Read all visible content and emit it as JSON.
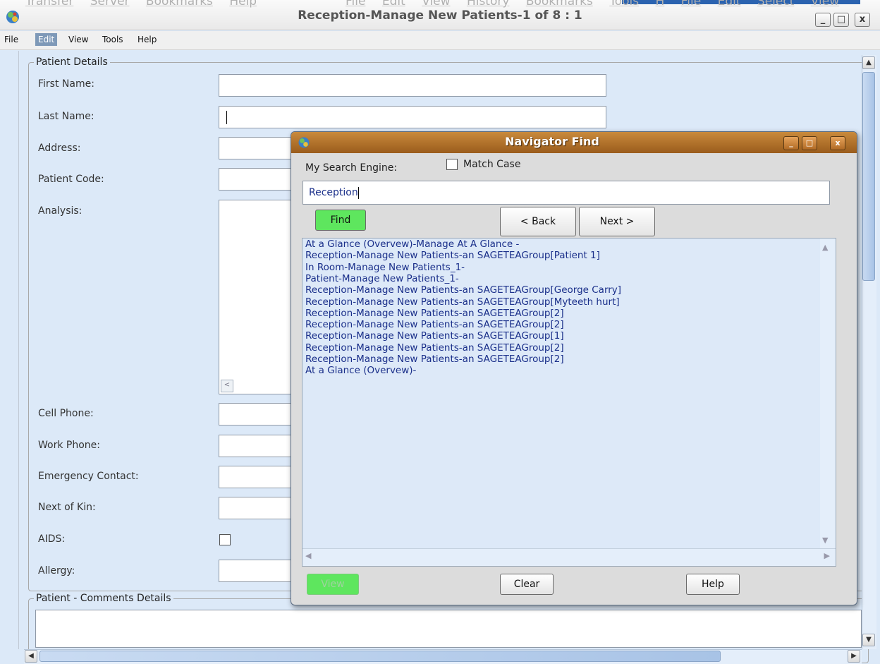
{
  "window": {
    "title": "Reception-Manage New Patients-1 of 8 : 1",
    "ghost_menu_left": [
      "Transfer",
      "Server",
      "Bookmarks",
      "Help"
    ],
    "ghost_menu_right": [
      "File",
      "Edit",
      "View",
      "History",
      "Bookmarks",
      "Tools",
      "H",
      "File",
      "Edit",
      "Select",
      "View"
    ],
    "controls": {
      "minimize": "_",
      "maximize": "□",
      "close": "x"
    }
  },
  "menubar": [
    "File",
    "Edit",
    "View",
    "Tools",
    "Help"
  ],
  "patient_details": {
    "legend": "Patient Details",
    "fields": {
      "first_name": "First Name:",
      "last_name": "Last Name:",
      "address": "Address:",
      "patient_code": "Patient Code:",
      "analysis": "Analysis:",
      "cell_phone": "Cell Phone:",
      "work_phone": "Work Phone:",
      "emergency_contact": "Emergency Contact:",
      "next_of_kin": "Next of Kin:",
      "aids": "AIDS:",
      "allergy": "Allergy:"
    },
    "values": {
      "first_name": "",
      "last_name": "",
      "address": "",
      "patient_code": ""
    }
  },
  "comments": {
    "legend": "Patient - Comments Details"
  },
  "dialog": {
    "title": "Navigator Find",
    "engine_label": "My Search Engine:",
    "match_case_label": "Match Case",
    "match_case_checked": false,
    "search_value": "Reception",
    "find": "Find",
    "back": "< Back",
    "next": "Next >",
    "view": "View",
    "clear": "Clear",
    "help": "Help",
    "find_color": "#5ee65e",
    "results": [
      "At a Glance (Overvew)-Manage At A Glance -",
      "Reception-Manage New Patients-an SAGETEAGroup[Patient 1]",
      "In Room-Manage New Patients_1-",
      "Patient-Manage New Patients_1-",
      "Reception-Manage New Patients-an SAGETEAGroup[George Carry]",
      "Reception-Manage New Patients-an SAGETEAGroup[Myteeth hurt]",
      "Reception-Manage New Patients-an SAGETEAGroup[2]",
      "Reception-Manage New Patients-an SAGETEAGroup[2]",
      "Reception-Manage New Patients-an SAGETEAGroup[1]",
      "Reception-Manage New Patients-an SAGETEAGroup[2]",
      "Reception-Manage New Patients-an SAGETEAGroup[2]",
      "At a Glance (Overvew)-"
    ]
  }
}
